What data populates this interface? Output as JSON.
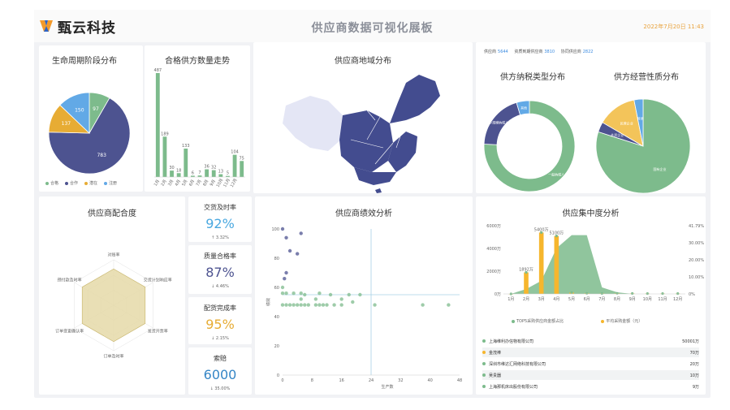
{
  "header": {
    "logo_text": "甄云科技",
    "title": "供应商数据可视化展板",
    "date": "2022年7月20日 11:43"
  },
  "colors": {
    "green": "#7dbb8c",
    "navy": "#4d5390",
    "orange": "#e7ac34",
    "blue": "#62a9e6",
    "map": "#434c8f",
    "map_light": "#e4e6f5",
    "kpi_blue": "#4aa8e0",
    "kpi_navy": "#4d5390",
    "kpi_orange": "#e7ac34",
    "kpi_teal": "#3586c6",
    "bar_orange": "#f6b62d"
  },
  "icons": {
    "logo": "logo-icon",
    "list_dot": "circle-bullet-icon"
  },
  "panels": {
    "lifecycle": {
      "title": "生命周期阶段分布"
    },
    "qualified": {
      "title": "合格供方数量走势"
    },
    "region": {
      "title": "供应商地域分布"
    },
    "stats": {
      "s1_label": "供应商",
      "s1_value": "5644",
      "s2_label": "资质到期供应商",
      "s2_value": "3810",
      "s3_label": "协同供应商",
      "s3_value": "2822"
    },
    "tax": {
      "title": "供方纳税类型分布"
    },
    "biz": {
      "title": "供方经营性质分布"
    },
    "fit": {
      "title": "供应商配合度"
    },
    "perf": {
      "title": "供应商绩效分析"
    },
    "conc": {
      "title": "供应集中度分析"
    }
  },
  "kpis": [
    {
      "title": "交货及时率",
      "value": "92%",
      "change": "↑ 3.32%"
    },
    {
      "title": "质量合格率",
      "value": "87%",
      "change": "↓ 4.46%"
    },
    {
      "title": "配货完成率",
      "value": "95%",
      "change": "↓ 2.15%"
    },
    {
      "title": "索赔",
      "value": "6000",
      "change": "↓ 35.00%"
    }
  ],
  "chart_data": [
    {
      "type": "pie",
      "title": "生命周期阶段分布",
      "slices": [
        {
          "name": "合格",
          "value": 97,
          "color": "#7dbb8c"
        },
        {
          "name": "合作",
          "value": 783,
          "color": "#4d5390"
        },
        {
          "name": "潜在",
          "value": 137,
          "color": "#e7ac34"
        },
        {
          "name": "注册",
          "value": 150,
          "color": "#62a9e6"
        }
      ]
    },
    {
      "type": "bar",
      "title": "合格供方数量走势",
      "categories": [
        "1月",
        "2月",
        "3月",
        "4月",
        "5月",
        "6月",
        "7月",
        "8月",
        "9月",
        "10月",
        "11月",
        "12月"
      ],
      "values": [
        487,
        189,
        30,
        18,
        133,
        6,
        7,
        36,
        32,
        13,
        5,
        104,
        75
      ]
    },
    {
      "type": "map",
      "title": "供应商地域分布"
    },
    {
      "type": "pie",
      "title": "供方纳税类型分布",
      "donut": true,
      "slices": [
        {
          "name": "一般纳税人",
          "value": 75.7,
          "color": "#7dbb8c"
        },
        {
          "name": "小规模纳税人",
          "value": 19.7,
          "color": "#4d5390"
        },
        {
          "name": "其他",
          "value": 4.6,
          "color": "#62a9e6"
        }
      ]
    },
    {
      "type": "pie",
      "title": "供方经营性质分布",
      "slices": [
        {
          "name": "国有企业",
          "value": 79.9,
          "color": "#7dbb8c"
        },
        {
          "name": "外资企业",
          "value": 3.5,
          "color": "#4d5390"
        },
        {
          "name": "民营企业",
          "value": 13.5,
          "color": "#f3c45a"
        },
        {
          "name": "其他",
          "value": 3.1,
          "color": "#62a9e6"
        }
      ]
    },
    {
      "type": "radar",
      "title": "供应商配合度",
      "axes": [
        "对账率",
        "交货计划响应率",
        "发货开票率",
        "订单及时率",
        "订单变更确认率",
        "预付款及时率"
      ],
      "values": [
        0.8,
        0.8,
        0.8,
        0.8,
        0.8,
        0.8
      ],
      "max": 1
    },
    {
      "type": "scatter",
      "title": "供应商绩效分析",
      "xlabel": "生产数",
      "ylabel": "绩效",
      "xlim": [
        0,
        48
      ],
      "ylim": [
        0,
        100
      ],
      "xticks": [
        0,
        8,
        16,
        24,
        32,
        40,
        48
      ],
      "yticks": [
        0,
        20,
        40,
        60,
        80,
        100
      ],
      "vline": 24,
      "hline": 55,
      "series": [
        {
          "color": "#4d5390",
          "points": [
            [
              0,
              100
            ],
            [
              1,
              94
            ],
            [
              2,
              85
            ],
            [
              5,
              97
            ],
            [
              4,
              83
            ],
            [
              1,
              70
            ],
            [
              0.5,
              66
            ]
          ]
        },
        {
          "color": "#7dbb8c",
          "points": [
            [
              0,
              48
            ],
            [
              1,
              48
            ],
            [
              2,
              48
            ],
            [
              3,
              48
            ],
            [
              4,
              48
            ],
            [
              5,
              48
            ],
            [
              6,
              48
            ],
            [
              7,
              48
            ],
            [
              9,
              48
            ],
            [
              10,
              48
            ],
            [
              11,
              48
            ],
            [
              12,
              48
            ],
            [
              14,
              48
            ],
            [
              16,
              48
            ],
            [
              19,
              50
            ],
            [
              25,
              48
            ],
            [
              38,
              48
            ],
            [
              45,
              48
            ],
            [
              0,
              56
            ],
            [
              1,
              56
            ],
            [
              3,
              56
            ],
            [
              5,
              56
            ],
            [
              6,
              55
            ],
            [
              10,
              56
            ],
            [
              13,
              55
            ],
            [
              18,
              55
            ],
            [
              21,
              55
            ],
            [
              5,
              52
            ],
            [
              9,
              52
            ],
            [
              16,
              52
            ],
            [
              0,
              60
            ]
          ]
        }
      ]
    },
    {
      "type": "bar",
      "title": "供应集中度分析",
      "categories": [
        "1月",
        "2月",
        "3月",
        "4月",
        "5月",
        "6月",
        "7月",
        "8月",
        "9月",
        "10月",
        "11月",
        "12月"
      ],
      "ylim": [
        0,
        6000
      ],
      "yticks": [
        "0万",
        "2000万",
        "4000万",
        "6000万"
      ],
      "y2ticks": [
        "0%",
        "10.00%",
        "20.00%",
        "30.00%",
        "41.79%"
      ],
      "series": [
        {
          "name": "TOP5采购供应商金额占比",
          "type": "area",
          "values": [
            0,
            3,
            8,
            28,
            36,
            36,
            4,
            1,
            0,
            0,
            0,
            0
          ]
        },
        {
          "name": "平均采购金额（元）",
          "type": "bar",
          "values": [
            0,
            1892,
            5400,
            5100,
            120,
            50,
            40,
            50,
            40,
            30,
            30,
            30
          ]
        }
      ],
      "labels": [
        "1892万",
        "5400万",
        "5100万"
      ]
    }
  ],
  "ranking": [
    {
      "name": "上海维利办信物有限公司",
      "value": "50001万",
      "color": "#7dbb8c"
    },
    {
      "name": "金茂棒",
      "value": "70万",
      "color": "#f6b62d"
    },
    {
      "name": "深圳市维达汇网络科技有限公司",
      "value": "20万",
      "color": "#7dbb8c"
    },
    {
      "name": "吴贵器",
      "value": "10万",
      "color": "#7dbb8c"
    },
    {
      "name": "上海那机床出股份有限公司",
      "value": "9万",
      "color": "#7dbb8c"
    }
  ]
}
